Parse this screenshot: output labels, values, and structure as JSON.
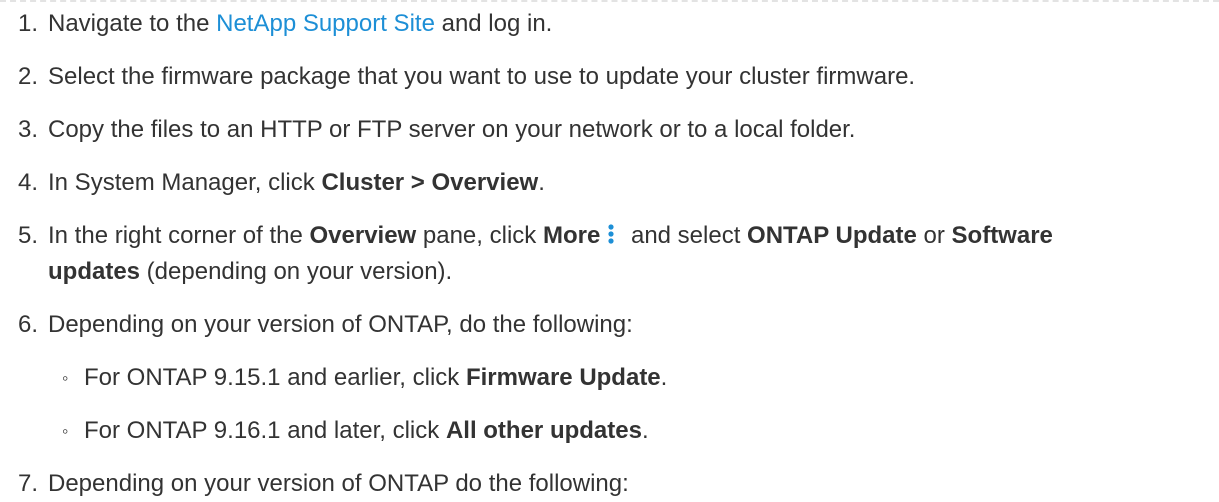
{
  "steps": [
    {
      "num": "1.",
      "pre": "Navigate to the ",
      "link": "NetApp Support Site",
      "post": " and log in."
    },
    {
      "num": "2.",
      "text": "Select the firmware package that you want to use to update your cluster firmware."
    },
    {
      "num": "3.",
      "text": "Copy the files to an HTTP or FTP server on your network or to a local folder."
    },
    {
      "num": "4.",
      "pre": "In System Manager, click ",
      "bold": "Cluster > Overview",
      "post": "."
    },
    {
      "num": "5.",
      "t1": "In the right corner of the ",
      "b1": "Overview",
      "t2": " pane, click ",
      "b2": "More",
      "t3": " and select ",
      "b3": "ONTAP Update",
      "t4": " or ",
      "b4": "Software",
      "b5": "updates",
      "t5": " (depending on your version)."
    },
    {
      "num": "6.",
      "text": "Depending on your version of ONTAP, do the following:",
      "subitems": [
        {
          "bullet": "◦",
          "pre": "For ONTAP 9.15.1 and earlier, click ",
          "bold": "Firmware Update",
          "post": "."
        },
        {
          "bullet": "◦",
          "pre": "For ONTAP 9.16.1 and later, click ",
          "bold": "All other updates",
          "post": "."
        }
      ]
    },
    {
      "num": "7.",
      "text": "Depending on your version of ONTAP do the following:"
    }
  ],
  "icons": {
    "more": "vertical-ellipsis-icon"
  },
  "colors": {
    "link": "#1d8fd6",
    "more_icon": "#1d8fd6",
    "text": "#333333"
  }
}
